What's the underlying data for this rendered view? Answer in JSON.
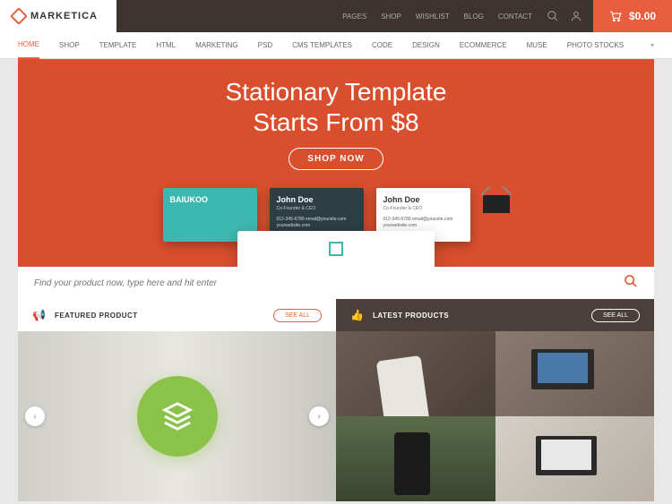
{
  "brand": "MARKETICA",
  "topnav": {
    "pages": "PAGES",
    "shop": "SHOP",
    "wishlist": "WISHLIST",
    "blog": "BLOG",
    "contact": "CONTACT"
  },
  "cart": {
    "symbol": "$",
    "amount": "0.00"
  },
  "nav": {
    "home": "HOME",
    "shop": "SHOP",
    "template": "TEMPLATE",
    "html": "HTML",
    "marketing": "MARKETING",
    "psd": "PSD",
    "cms": "CMS TEMPLATES",
    "code": "CODE",
    "design": "DESIGN",
    "ecommerce": "ECOMMERCE",
    "muse": "MUSE",
    "stocks": "PHOTO STOCKS"
  },
  "hero": {
    "line1": "Stationary Template",
    "line2": "Starts From $8",
    "cta": "SHOP NOW"
  },
  "bizcards": {
    "teal": {
      "title": "BAIUKOO",
      "sub": "",
      "lines": ""
    },
    "dark": {
      "title": "John Doe",
      "sub": "Co-Founder & CEO",
      "lines": "012-345-6789\nemail@yoursite.com\nyourwebsite.com"
    },
    "white": {
      "title": "John Doe",
      "sub": "Co-Founder & CEO",
      "lines": "012-345-6789\nemail@yoursite.com\nyourwebsite.com"
    }
  },
  "search": {
    "placeholder": "Find your product now, type here and hit enter"
  },
  "sections": {
    "featured": "FEATURED PRODUCT",
    "latest": "LATEST PRODUCTS",
    "seeall": "SEE ALL"
  }
}
